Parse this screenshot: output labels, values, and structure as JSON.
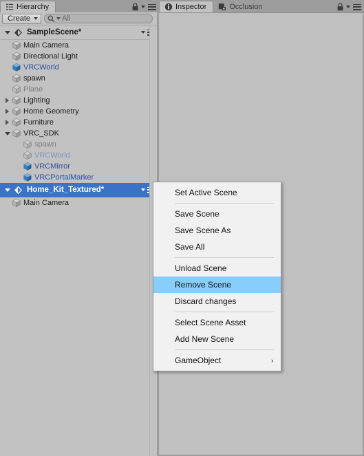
{
  "hierarchy": {
    "tab_label": "Hierarchy",
    "tab_icon": "hierarchy-icon",
    "lock_icon": "lock-icon",
    "menu_icon": "panel-menu-icon",
    "toolbar": {
      "create_label": "Create",
      "create_dropdown_icon": "chevron-down-icon",
      "search_icon": "search-icon",
      "search_value": "All",
      "search_placeholder": "All"
    },
    "scenes": [
      {
        "name": "SampleScene*",
        "expanded": true,
        "selected": false,
        "icon": "unity-scene-icon",
        "menu_icon": "scene-menu-icon",
        "items": [
          {
            "label": "Main Camera",
            "depth": 1,
            "twist": "none",
            "icon": "gameobject-cube-icon",
            "style": "normal",
            "prefab_arrow": false
          },
          {
            "label": "Directional Light",
            "depth": 1,
            "twist": "none",
            "icon": "gameobject-cube-icon",
            "style": "normal",
            "prefab_arrow": false
          },
          {
            "label": "VRCWorld",
            "depth": 1,
            "twist": "none",
            "icon": "prefab-cube-icon",
            "style": "prefab",
            "prefab_arrow": true
          },
          {
            "label": "spawn",
            "depth": 1,
            "twist": "none",
            "icon": "gameobject-cube-icon",
            "style": "normal",
            "prefab_arrow": false
          },
          {
            "label": "Plane",
            "depth": 1,
            "twist": "none",
            "icon": "gameobject-cube-icon",
            "style": "dim",
            "prefab_arrow": false
          },
          {
            "label": "Lighting",
            "depth": 1,
            "twist": "right",
            "icon": "gameobject-cube-icon",
            "style": "normal",
            "prefab_arrow": false
          },
          {
            "label": "Home Geometry",
            "depth": 1,
            "twist": "right",
            "icon": "gameobject-cube-icon",
            "style": "normal",
            "prefab_arrow": false
          },
          {
            "label": "Furniture",
            "depth": 1,
            "twist": "right",
            "icon": "gameobject-cube-icon",
            "style": "normal",
            "prefab_arrow": false
          },
          {
            "label": "VRC_SDK",
            "depth": 1,
            "twist": "down",
            "icon": "gameobject-cube-icon",
            "style": "normal",
            "prefab_arrow": false
          },
          {
            "label": "spawn",
            "depth": 2,
            "twist": "none",
            "icon": "gameobject-cube-icon",
            "style": "dim",
            "prefab_arrow": false
          },
          {
            "label": "VRCWorld",
            "depth": 2,
            "twist": "none",
            "icon": "prefab-cube-icon",
            "style": "prefab-dim",
            "prefab_arrow": true
          },
          {
            "label": "VRCMirror",
            "depth": 2,
            "twist": "none",
            "icon": "prefab-cube-icon",
            "style": "prefab",
            "prefab_arrow": true
          },
          {
            "label": "VRCPortalMarker",
            "depth": 2,
            "twist": "none",
            "icon": "prefab-cube-icon",
            "style": "prefab",
            "prefab_arrow": true
          }
        ]
      },
      {
        "name": "Home_Kit_Textured*",
        "expanded": true,
        "selected": true,
        "icon": "unity-scene-icon",
        "menu_icon": "scene-menu-icon",
        "items": [
          {
            "label": "Main Camera",
            "depth": 1,
            "twist": "none",
            "icon": "gameobject-cube-icon",
            "style": "normal",
            "prefab_arrow": false
          }
        ]
      }
    ]
  },
  "inspector": {
    "tabs": [
      {
        "label": "Inspector",
        "icon": "info-circle-icon",
        "active": true
      },
      {
        "label": "Occlusion",
        "icon": "occlusion-icon",
        "active": false
      }
    ],
    "lock_icon": "lock-icon",
    "menu_icon": "panel-menu-icon"
  },
  "context_menu": {
    "items": [
      {
        "label": "Set Active Scene",
        "highlight": false,
        "submenu": false
      },
      {
        "type": "separator"
      },
      {
        "label": "Save Scene",
        "highlight": false,
        "submenu": false
      },
      {
        "label": "Save Scene As",
        "highlight": false,
        "submenu": false
      },
      {
        "label": "Save All",
        "highlight": false,
        "submenu": false
      },
      {
        "type": "separator"
      },
      {
        "label": "Unload Scene",
        "highlight": false,
        "submenu": false
      },
      {
        "label": "Remove Scene",
        "highlight": true,
        "submenu": false
      },
      {
        "label": "Discard changes",
        "highlight": false,
        "submenu": false
      },
      {
        "type": "separator"
      },
      {
        "label": "Select Scene Asset",
        "highlight": false,
        "submenu": false
      },
      {
        "label": "Add New Scene",
        "highlight": false,
        "submenu": false
      },
      {
        "type": "separator"
      },
      {
        "label": "GameObject",
        "highlight": false,
        "submenu": true,
        "submenu_arrow": "›"
      }
    ]
  },
  "colors": {
    "panel_bg": "#c2c2c2",
    "chrome_bg": "#9d9d9d",
    "selection_blue": "#3a73c8",
    "menu_highlight": "#87cefa",
    "prefab_blue": "#2b4f9e",
    "menu_bg": "#f1f1f1"
  }
}
